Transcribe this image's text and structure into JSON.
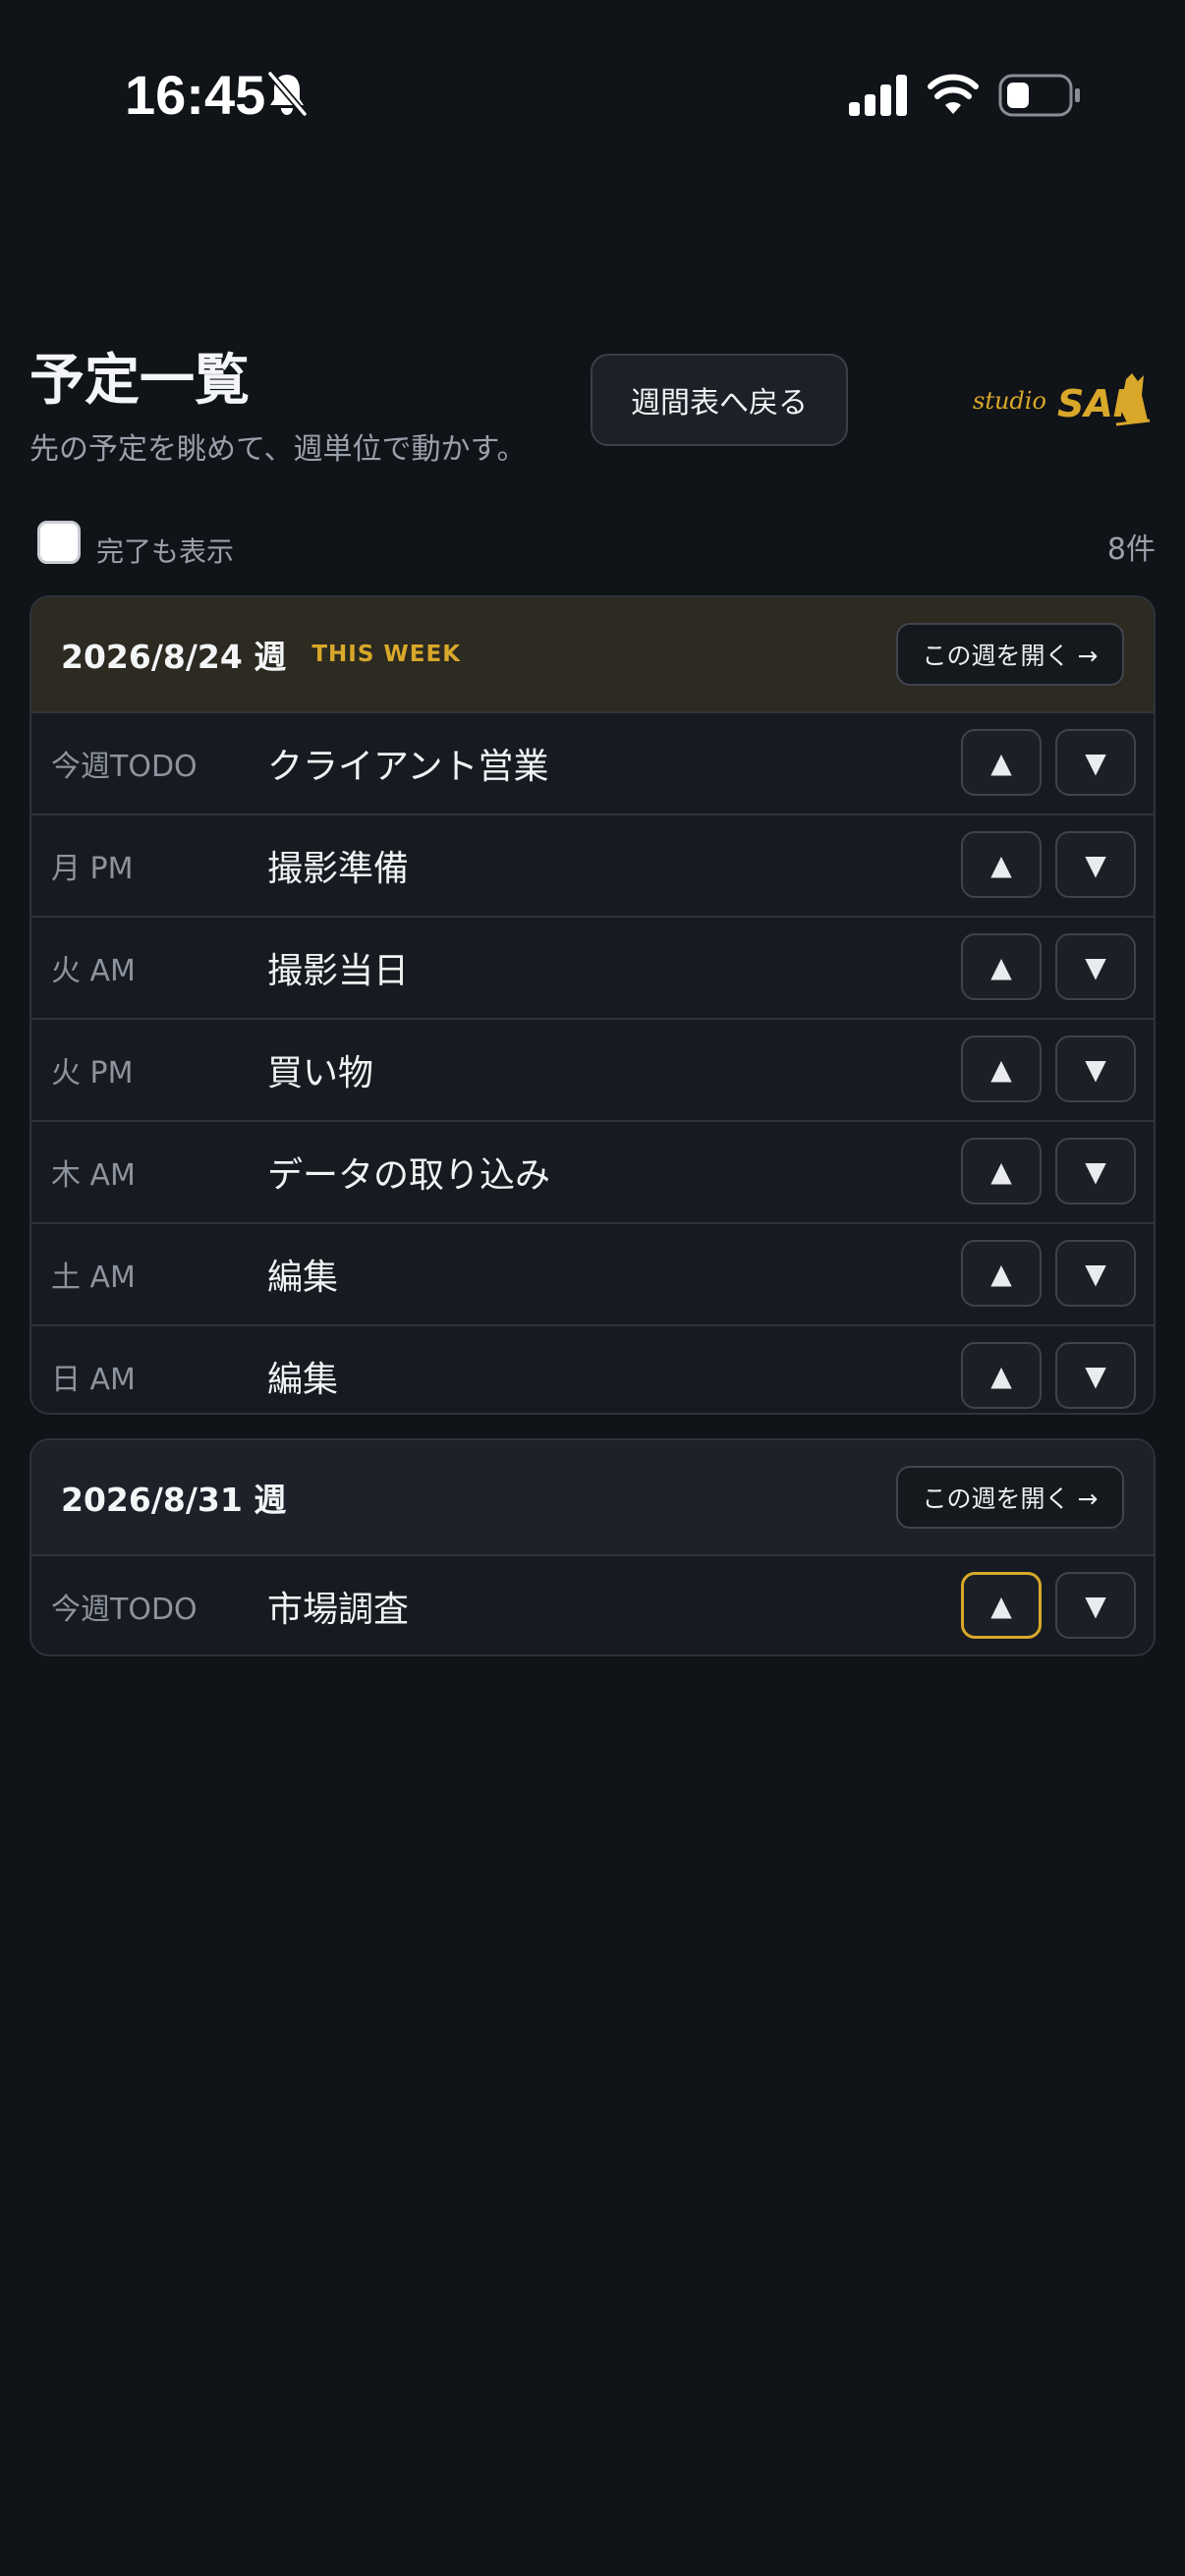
{
  "status_bar": {
    "time": "16:45",
    "icons": [
      "bell-off-icon",
      "signal-icon",
      "wifi-icon",
      "battery-icon"
    ],
    "battery_level": 0.2
  },
  "header": {
    "title": "予定一覧",
    "subtitle": "先の予定を眺めて、週単位で動かす。",
    "back_button_label": "週間表へ戻る",
    "brand": "studio SAI"
  },
  "filter": {
    "show_done_label": "完了も表示",
    "show_done_checked": false,
    "count": "8件"
  },
  "colors": {
    "background": "#101318",
    "accent": "#d9a82a",
    "current_week_header": "#2c2a21"
  },
  "weeks": [
    {
      "date": "2026/8/24 週",
      "badge": "THIS WEEK",
      "open_label": "この週を開く →",
      "tasks": [
        {
          "slot": "今週TODO",
          "title": "クライアント営業",
          "up": "▲",
          "down": "▼"
        },
        {
          "slot": "月 PM",
          "title": "撮影準備",
          "up": "▲",
          "down": "▼"
        },
        {
          "slot": "火 AM",
          "title": "撮影当日",
          "up": "▲",
          "down": "▼"
        },
        {
          "slot": "火 PM",
          "title": "買い物",
          "up": "▲",
          "down": "▼"
        },
        {
          "slot": "木 AM",
          "title": "データの取り込み",
          "up": "▲",
          "down": "▼"
        },
        {
          "slot": "土 AM",
          "title": "編集",
          "up": "▲",
          "down": "▼"
        },
        {
          "slot": "日 AM",
          "title": "編集",
          "up": "▲",
          "down": "▼"
        }
      ]
    },
    {
      "date": "2026/8/31 週",
      "open_label": "この週を開く →",
      "tasks": [
        {
          "slot": "今週TODO",
          "title": "市場調査",
          "up": "▲",
          "down": "▼"
        }
      ]
    }
  ]
}
